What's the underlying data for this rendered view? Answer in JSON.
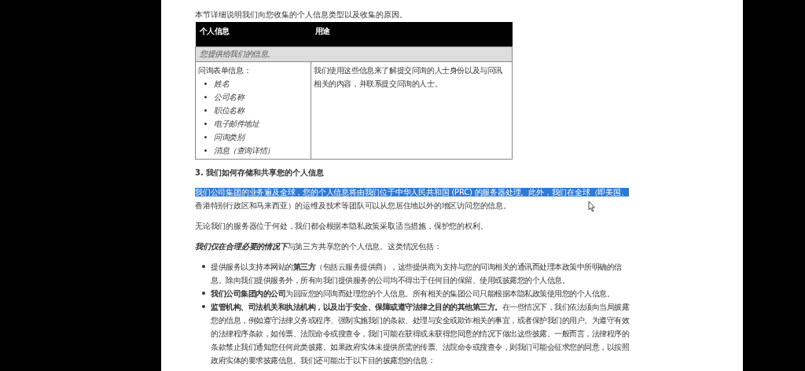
{
  "intro": "本节详细说明我们向您收集的个人信息类型以及收集的原因。",
  "table": {
    "columns": [
      "个人信息",
      "用途"
    ],
    "section_row": "您提供给我们的信息。",
    "rows": [
      {
        "label": "问询表单信息：",
        "items": [
          "姓名",
          "公司名称",
          "职位名称",
          "电子邮件地址",
          "问询类别",
          "消息（查询详情）"
        ],
        "purpose": "我们使用这些信息来了解提交问询的人士身份以及与问讯相关的内容，并联系提交问询的人士。"
      }
    ]
  },
  "heading": "3. 我们如何存储和共享您的个人信息",
  "paragraphs": [
    {
      "selected_text": "我们公司集团的业务遍及全球，您的个人信息将由我们位于中华人民共和国 (PRC) 的服务器处理。此外，我们在全球（即美国、",
      "text": "香港特别行政区和马来西亚）的运维及技术等团队可以从您居住地以外的地区访问您的信息。"
    },
    {
      "text": "无论我们的服务器位于何处，我们都会根据本隐私政策采取适当措施，保护您的权利。"
    },
    {
      "text": "**我们仅在合理必要的情况下**与第三方共享您的个人信息。这类情况包括："
    }
  ],
  "bullets": [
    "提供服务以支持本网站的**第三方**（包括云服务提供商），这些提供商为支持与您的问询相关的通讯而处理本政策中所明确的信息。除向我们提供服务外，所有向我们提供服务的公司均不得出于任何目的保留、使用或披露您的个人信息。",
    "**我们公司集团内的公司**为回应您的问询而处理您的个人信息。所有相关的集团公司只能根据本隐私政策使用您的个人信息。",
    "**监管机构、司法机关和执法机构，以及出于安全、保障或遵守法律之目的的其他第三方。**在一些情况下，我们依法须向当局披露您的信息，例如遵守法律义务或程序、强制实施我们的条款、处理与安全或欺诈相关的事宜，或者保护我们的用户。为遵守有效的法律程序条款，如传票、法院命令或搜查令，我们可能在获得或未获得您同意的情况下做出这些披露。一般而言，法律程序的条款禁止我们通知您任何此类披露。如果政府实体未提供所需的传票、法院命令或搜查令，则我们可能会征求您的同意，以按照政府实体的要求披露信息。我们还可能出于以下目的披露您的信息："
  ]
}
